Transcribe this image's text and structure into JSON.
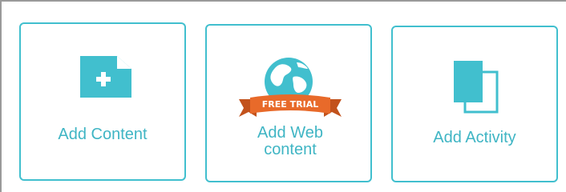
{
  "cards": [
    {
      "label": "Add Content",
      "icon": "add-file-icon"
    },
    {
      "label": "Add Web content",
      "icon": "globe-icon",
      "badge": "FREE TRIAL"
    },
    {
      "label": "Add Activity",
      "icon": "activity-pages-icon"
    }
  ],
  "colors": {
    "accent": "#41bfce",
    "label": "#3fb5c4",
    "ribbon": "#e86a2a",
    "frame": "#9a9a9a"
  }
}
